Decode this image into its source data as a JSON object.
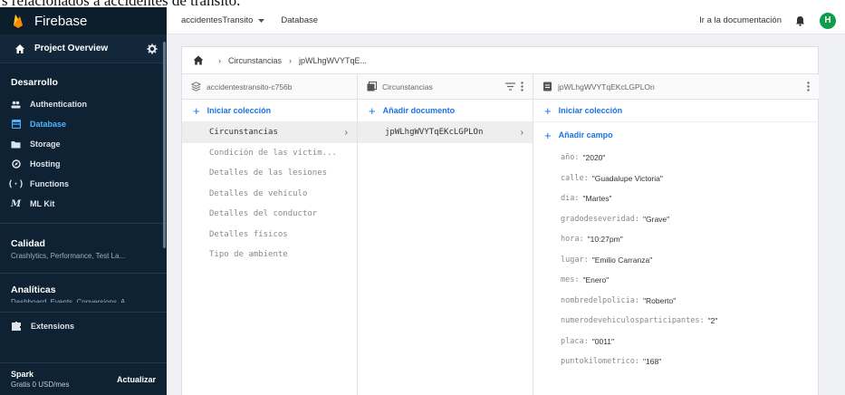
{
  "caption": "s relacionados a accidentes de tránsito.",
  "sidebar": {
    "brand": "Firebase",
    "project_overview": "Project Overview",
    "section_dev": "Desarrollo",
    "nav": [
      {
        "label": "Authentication",
        "icon": "people-icon",
        "active": false
      },
      {
        "label": "Database",
        "icon": "database-icon",
        "active": true
      },
      {
        "label": "Storage",
        "icon": "storage-icon",
        "active": false
      },
      {
        "label": "Hosting",
        "icon": "hosting-icon",
        "active": false
      },
      {
        "label": "Functions",
        "icon": "functions-icon",
        "active": false
      },
      {
        "label": "ML Kit",
        "icon": "mlkit-icon",
        "active": false
      }
    ],
    "quality_title": "Calidad",
    "quality_sub": "Crashlytics, Performance, Test La...",
    "analytics_title": "Analíticas",
    "analytics_sub": "Dashboard, Events, Conversions, A...",
    "extensions": "Extensions",
    "plan_name": "Spark",
    "plan_price": "Gratis 0 USD/mes",
    "upgrade": "Actualizar"
  },
  "topbar": {
    "project": "accidentesTransito",
    "section": "Database",
    "docs_link": "Ir a la documentación",
    "avatar_letter": "H"
  },
  "breadcrumb": {
    "items": [
      "Circunstancias",
      "jpWLhgWVYTqE..."
    ]
  },
  "columns": {
    "root": {
      "header": "accidentestransito-c756b",
      "add_label": "Iniciar colección",
      "items": [
        {
          "label": "Circunstancias",
          "selected": true
        },
        {
          "label": "Condición de las víctim...",
          "selected": false
        },
        {
          "label": "Detalles de las lesiones",
          "selected": false
        },
        {
          "label": "Detalles de vehículo",
          "selected": false
        },
        {
          "label": "Detalles del conductor",
          "selected": false
        },
        {
          "label": "Detalles físicos",
          "selected": false
        },
        {
          "label": "Tipo de ambiente",
          "selected": false
        }
      ]
    },
    "collection": {
      "header": "Circunstancias",
      "add_label": "Añadir documento",
      "items": [
        {
          "label": "jpWLhgWVYTqEKcLGPLOn",
          "selected": true
        }
      ]
    },
    "document": {
      "header": "jpWLhgWVYTqEKcLGPLOn",
      "add_collection": "Iniciar colección",
      "add_field": "Añadir campo",
      "fields": [
        {
          "key": "año:",
          "value": "\"2020\""
        },
        {
          "key": "calle:",
          "value": "\"Guadalupe Victoria\""
        },
        {
          "key": "dia:",
          "value": "\"Martes\""
        },
        {
          "key": "gradodeseveridad:",
          "value": "\"Grave\""
        },
        {
          "key": "hora:",
          "value": "\"10:27pm\""
        },
        {
          "key": "lugar:",
          "value": "\"Emilio Carranza\""
        },
        {
          "key": "mes:",
          "value": "\"Enero\""
        },
        {
          "key": "nombredelpolicia:",
          "value": "\"Roberto\""
        },
        {
          "key": "numerodevehiculosparticipantes:",
          "value": "\"2\""
        },
        {
          "key": "placa:",
          "value": "\"0011\""
        },
        {
          "key": "puntokilometrico:",
          "value": "\"168\""
        }
      ]
    }
  },
  "colors": {
    "sidebar_bg": "#0f2233",
    "accent_blue": "#1a73e8",
    "active_nav": "#4fb3ff",
    "avatar": "#0e9e4a",
    "flame": "#ffa000"
  }
}
